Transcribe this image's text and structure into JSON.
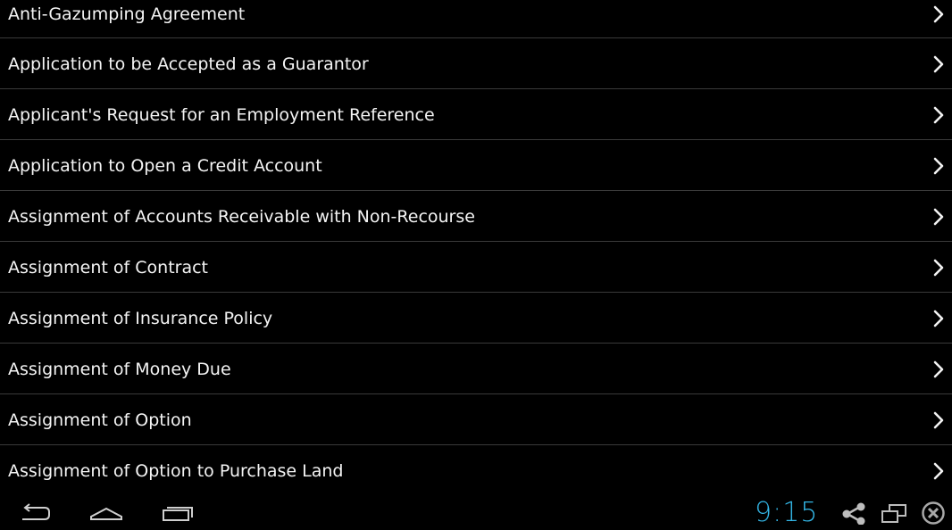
{
  "list": {
    "items": [
      {
        "label": "Anti-Gazumping Agreement"
      },
      {
        "label": "Application to be Accepted as a Guarantor"
      },
      {
        "label": "Applicant's Request for an Employment Reference"
      },
      {
        "label": "Application to Open a Credit Account"
      },
      {
        "label": "Assignment of Accounts Receivable with Non-Recourse"
      },
      {
        "label": "Assignment of Contract"
      },
      {
        "label": "Assignment of Insurance Policy"
      },
      {
        "label": "Assignment of Money Due"
      },
      {
        "label": "Assignment of Option"
      },
      {
        "label": "Assignment of Option to Purchase Land"
      }
    ],
    "chevron_icon": "chevron-right-icon"
  },
  "navbar": {
    "back_icon": "back-icon",
    "home_icon": "home-icon",
    "recents_icon": "recent-apps-icon",
    "clock": "9:15",
    "share_icon": "share-icon",
    "screens_icon": "multi-window-icon",
    "close_icon": "close-icon",
    "clock_color": "#33b5e5"
  }
}
